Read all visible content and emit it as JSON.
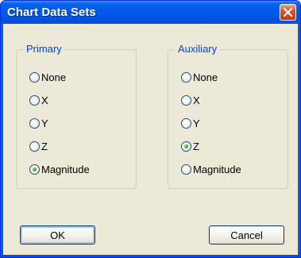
{
  "window": {
    "title": "Chart Data Sets"
  },
  "groups": {
    "primary": {
      "title": "Primary",
      "options": [
        {
          "label": "None",
          "selected": false
        },
        {
          "label": "X",
          "selected": false
        },
        {
          "label": "Y",
          "selected": false
        },
        {
          "label": "Z",
          "selected": false
        },
        {
          "label": "Magnitude",
          "selected": true
        }
      ]
    },
    "auxiliary": {
      "title": "Auxiliary",
      "options": [
        {
          "label": "None",
          "selected": false
        },
        {
          "label": "X",
          "selected": false
        },
        {
          "label": "Y",
          "selected": false
        },
        {
          "label": "Z",
          "selected": true
        },
        {
          "label": "Magnitude",
          "selected": false
        }
      ]
    }
  },
  "buttons": {
    "ok": "OK",
    "cancel": "Cancel"
  },
  "colors": {
    "titlebar": "#0054e3",
    "dialog_bg": "#ece9d8",
    "group_title": "#0046d5",
    "close_button": "#d8542d",
    "radio_selected": "#3aa01f"
  },
  "icons": {
    "close": "close-icon"
  }
}
